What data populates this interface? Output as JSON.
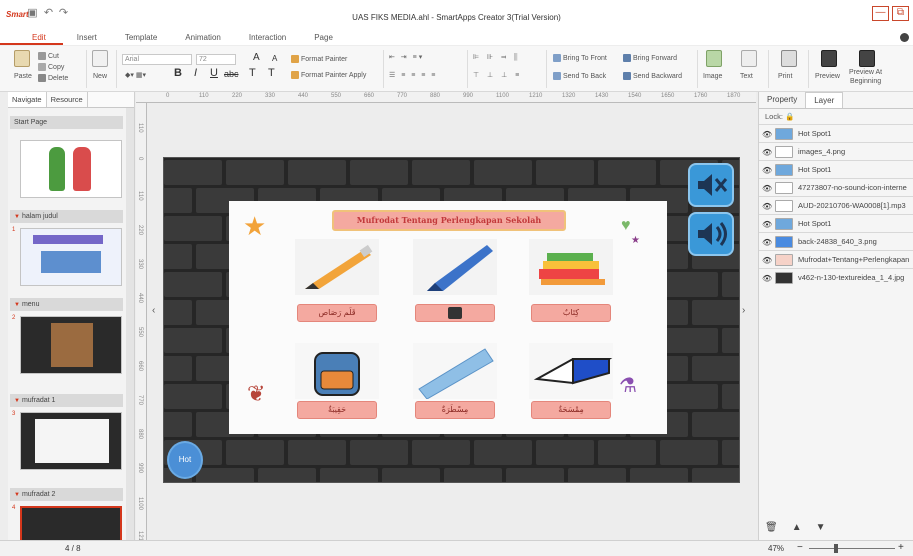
{
  "app": {
    "logo": "Smart",
    "window_title": "UAS FIKS MEDIA.ahl - SmartApps Creator 3(Trial Version)",
    "window_controls": {
      "minimize": "—",
      "restore": "⧉"
    }
  },
  "menu_tabs": [
    "Edit",
    "Insert",
    "Template",
    "Animation",
    "Interaction",
    "Page"
  ],
  "ribbon": {
    "paste": "Paste",
    "cut": "Cut",
    "copy": "Copy",
    "delete": "Delete",
    "new": "New",
    "font_name": "Arial",
    "font_size": "72",
    "grow": "A",
    "shrink": "A",
    "format_painter": "Format Painter",
    "format_painter_apply": "Format Painter Apply",
    "bold": "B",
    "italic": "I",
    "underline": "U",
    "strike": "abc",
    "text_color": "T",
    "text_effect": "T",
    "bring_to_front": "Bring To Front",
    "bring_forward": "Bring Forward",
    "send_to_back": "Send To Back",
    "send_backward": "Send Backward",
    "image": "Image",
    "text": "Text",
    "print": "Print",
    "preview": "Preview",
    "preview_at_beginning_1": "Preview At",
    "preview_at_beginning_2": "Beginning"
  },
  "left_panel": {
    "tabs": [
      "Navigate",
      "Resource"
    ],
    "start_page": "Start Page",
    "sections": [
      {
        "title": "halam judul",
        "page": "1"
      },
      {
        "title": "menu",
        "page": "2"
      },
      {
        "title": "mufradat 1",
        "page": "3"
      },
      {
        "title": "mufradat 2",
        "page": "4"
      }
    ]
  },
  "ruler": {
    "h": [
      "0",
      "110",
      "220",
      "330",
      "440",
      "550",
      "660",
      "770",
      "880",
      "990",
      "1100",
      "1210",
      "1320",
      "1430",
      "1540",
      "1650",
      "1760",
      "1870"
    ],
    "v": [
      "110",
      "0",
      "110",
      "220",
      "330",
      "440",
      "550",
      "660",
      "770",
      "880",
      "990",
      "1100",
      "1210"
    ]
  },
  "canvas": {
    "title": "Mufrodat Tentang Perlengkapan Sekolah",
    "items": [
      {
        "label": "قَلَم رَصَاص",
        "icon": "pencil-icon"
      },
      {
        "label": "",
        "icon": "pen-icon"
      },
      {
        "label": "كِتَابٌ",
        "icon": "books-icon"
      },
      {
        "label": "حَقِيبَةٌ",
        "icon": "school-bag-icon"
      },
      {
        "label": "مِسْطَرَةٌ",
        "icon": "ruler-icon"
      },
      {
        "label": "مِمْسَحَةٌ",
        "icon": "eraser-icon"
      }
    ],
    "hot_button": "Hot",
    "sound_off_icon": "speaker-mute-icon",
    "sound_on_icon": "speaker-icon"
  },
  "right_panel": {
    "tabs": [
      "Property",
      "Layer"
    ],
    "lock_label": "Lock:",
    "layers": [
      "Hot Spot1",
      "images_4.png",
      "Hot Spot1",
      "47273807-no-sound-icon-interne",
      "AUD-20210706-WA0008[1].mp3",
      "Hot Spot1",
      "back-24838_640_3.png",
      "Mufrodat+Tentang+Perlengkapan",
      "v462-n-130-textureidea_1_4.jpg"
    ]
  },
  "status": {
    "page_indicator": "4 / 8",
    "zoom": "47%",
    "zoom_level": 0.47
  },
  "colors": {
    "accent": "#d4371c",
    "board_title_bg": "#f4a9a0",
    "canvas_btn": "#3a98d8"
  }
}
